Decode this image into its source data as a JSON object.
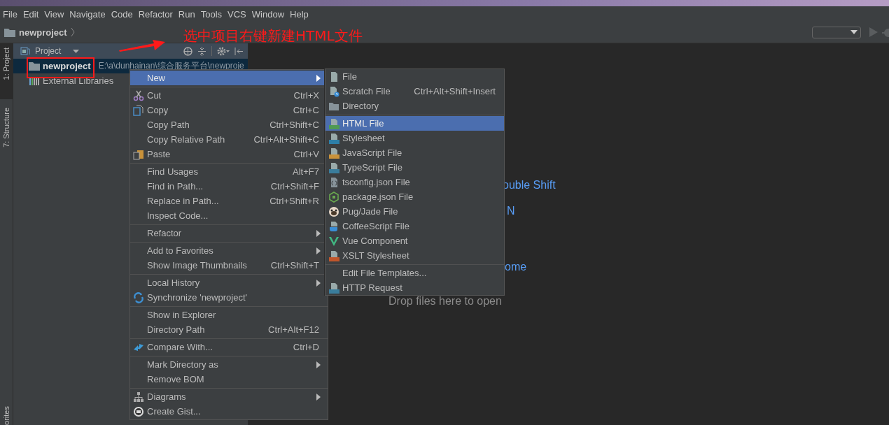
{
  "menu_bar": [
    "File",
    "Edit",
    "View",
    "Navigate",
    "Code",
    "Refactor",
    "Run",
    "Tools",
    "VCS",
    "Window",
    "Help"
  ],
  "breadcrumb": {
    "label": "newproject"
  },
  "annotation": {
    "text": "选中项目右键新建HTML文件"
  },
  "tool_tabs": [
    {
      "label": "1: Project",
      "selected": true
    },
    {
      "label": "7: Structure",
      "selected": false
    }
  ],
  "bottom_tool_tab": {
    "label": "orites"
  },
  "project_panel": {
    "title": "Project",
    "tree": [
      {
        "name": "newproject",
        "path": "E:\\a\\dunhainan\\综合服务平台\\newproje",
        "kind": "folder",
        "selected": true
      },
      {
        "name": "External Libraries",
        "kind": "library",
        "selected": false
      }
    ]
  },
  "editor_hints": [
    {
      "text": "ouble Shift",
      "kind": "shortcut"
    },
    {
      "text": "N",
      "kind": "shortcut"
    },
    {
      "text": "ome",
      "kind": "shortcut"
    },
    {
      "text": "Drop files here to open",
      "kind": "drop"
    }
  ],
  "context_menu": {
    "groups": [
      [
        {
          "label": "New",
          "selected": true,
          "submenu": true
        }
      ],
      [
        {
          "label": "Cut",
          "shortcut": "Ctrl+X",
          "kind": "cut",
          "selected": false
        },
        {
          "label": "Copy",
          "shortcut": "Ctrl+C",
          "kind": "copy",
          "selected": false
        },
        {
          "label": "Copy Path",
          "shortcut": "Ctrl+Shift+C",
          "selected": false
        },
        {
          "label": "Copy Relative Path",
          "shortcut": "Ctrl+Alt+Shift+C",
          "selected": false
        },
        {
          "label": "Paste",
          "shortcut": "Ctrl+V",
          "kind": "paste",
          "selected": false
        }
      ],
      [
        {
          "label": "Find Usages",
          "shortcut": "Alt+F7",
          "selected": false
        },
        {
          "label": "Find in Path...",
          "shortcut": "Ctrl+Shift+F",
          "selected": false
        },
        {
          "label": "Replace in Path...",
          "shortcut": "Ctrl+Shift+R",
          "selected": false
        },
        {
          "label": "Inspect Code...",
          "selected": false
        }
      ],
      [
        {
          "label": "Refactor",
          "selected": false,
          "submenu": true
        }
      ],
      [
        {
          "label": "Add to Favorites",
          "selected": false,
          "submenu": true
        },
        {
          "label": "Show Image Thumbnails",
          "shortcut": "Ctrl+Shift+T",
          "selected": false
        }
      ],
      [
        {
          "label": "Local History",
          "selected": false,
          "submenu": true
        },
        {
          "label": "Synchronize 'newproject'",
          "kind": "sync",
          "selected": false
        }
      ],
      [
        {
          "label": "Show in Explorer",
          "selected": false
        },
        {
          "label": "Directory Path",
          "shortcut": "Ctrl+Alt+F12",
          "selected": false
        }
      ],
      [
        {
          "label": "Compare With...",
          "shortcut": "Ctrl+D",
          "kind": "compare",
          "selected": false
        }
      ],
      [
        {
          "label": "Mark Directory as",
          "selected": false,
          "submenu": true
        },
        {
          "label": "Remove BOM",
          "selected": false
        }
      ],
      [
        {
          "label": "Diagrams",
          "kind": "diagram",
          "selected": false,
          "submenu": true
        },
        {
          "label": "Create Gist...",
          "kind": "gist",
          "selected": false
        }
      ]
    ]
  },
  "new_submenu": {
    "groups": [
      [
        {
          "label": "File",
          "kind": "file",
          "selected": false
        },
        {
          "label": "Scratch File",
          "shortcut": "Ctrl+Alt+Shift+Insert",
          "kind": "scratch",
          "selected": false
        },
        {
          "label": "Directory",
          "kind": "folder",
          "selected": false
        }
      ],
      [
        {
          "label": "HTML File",
          "kind": "html",
          "selected": true
        },
        {
          "label": "Stylesheet",
          "kind": "css",
          "selected": false
        },
        {
          "label": "JavaScript File",
          "kind": "js",
          "selected": false
        },
        {
          "label": "TypeScript File",
          "kind": "ts",
          "selected": false
        },
        {
          "label": "tsconfig.json File",
          "kind": "tsconfig",
          "selected": false
        },
        {
          "label": "package.json File",
          "kind": "node",
          "selected": false
        },
        {
          "label": "Pug/Jade File",
          "kind": "pug",
          "selected": false
        },
        {
          "label": "CoffeeScript File",
          "kind": "coffee",
          "selected": false
        },
        {
          "label": "Vue Component",
          "kind": "vue",
          "selected": false
        },
        {
          "label": "XSLT Stylesheet",
          "kind": "xslt",
          "selected": false
        }
      ],
      [
        {
          "label": "Edit File Templates...",
          "selected": false
        },
        {
          "label": "HTTP Request",
          "kind": "api",
          "selected": false
        }
      ]
    ]
  }
}
